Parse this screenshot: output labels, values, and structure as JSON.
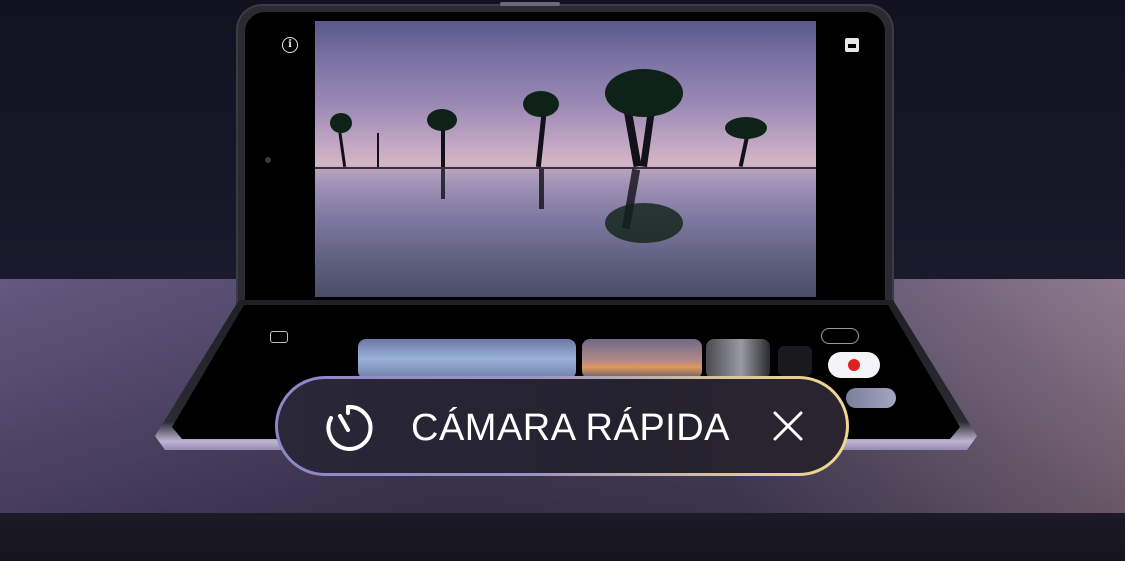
{
  "banner": {
    "label": "CÁMARA RÁPIDA",
    "timer_icon": "timer-icon",
    "close_icon": "close-icon"
  },
  "camera_ui": {
    "top_left_icon": "info-icon",
    "top_right_icon": "gallery-icon",
    "bottom_left_icon": "switch-camera-icon",
    "record_button_color": "#e02020",
    "thumbnails": [
      "thumbnail-1",
      "thumbnail-2",
      "thumbnail-3"
    ]
  },
  "colors": {
    "pill_border_start": "#8e86c8",
    "pill_border_end": "#f0d88c",
    "text": "#ffffff"
  }
}
